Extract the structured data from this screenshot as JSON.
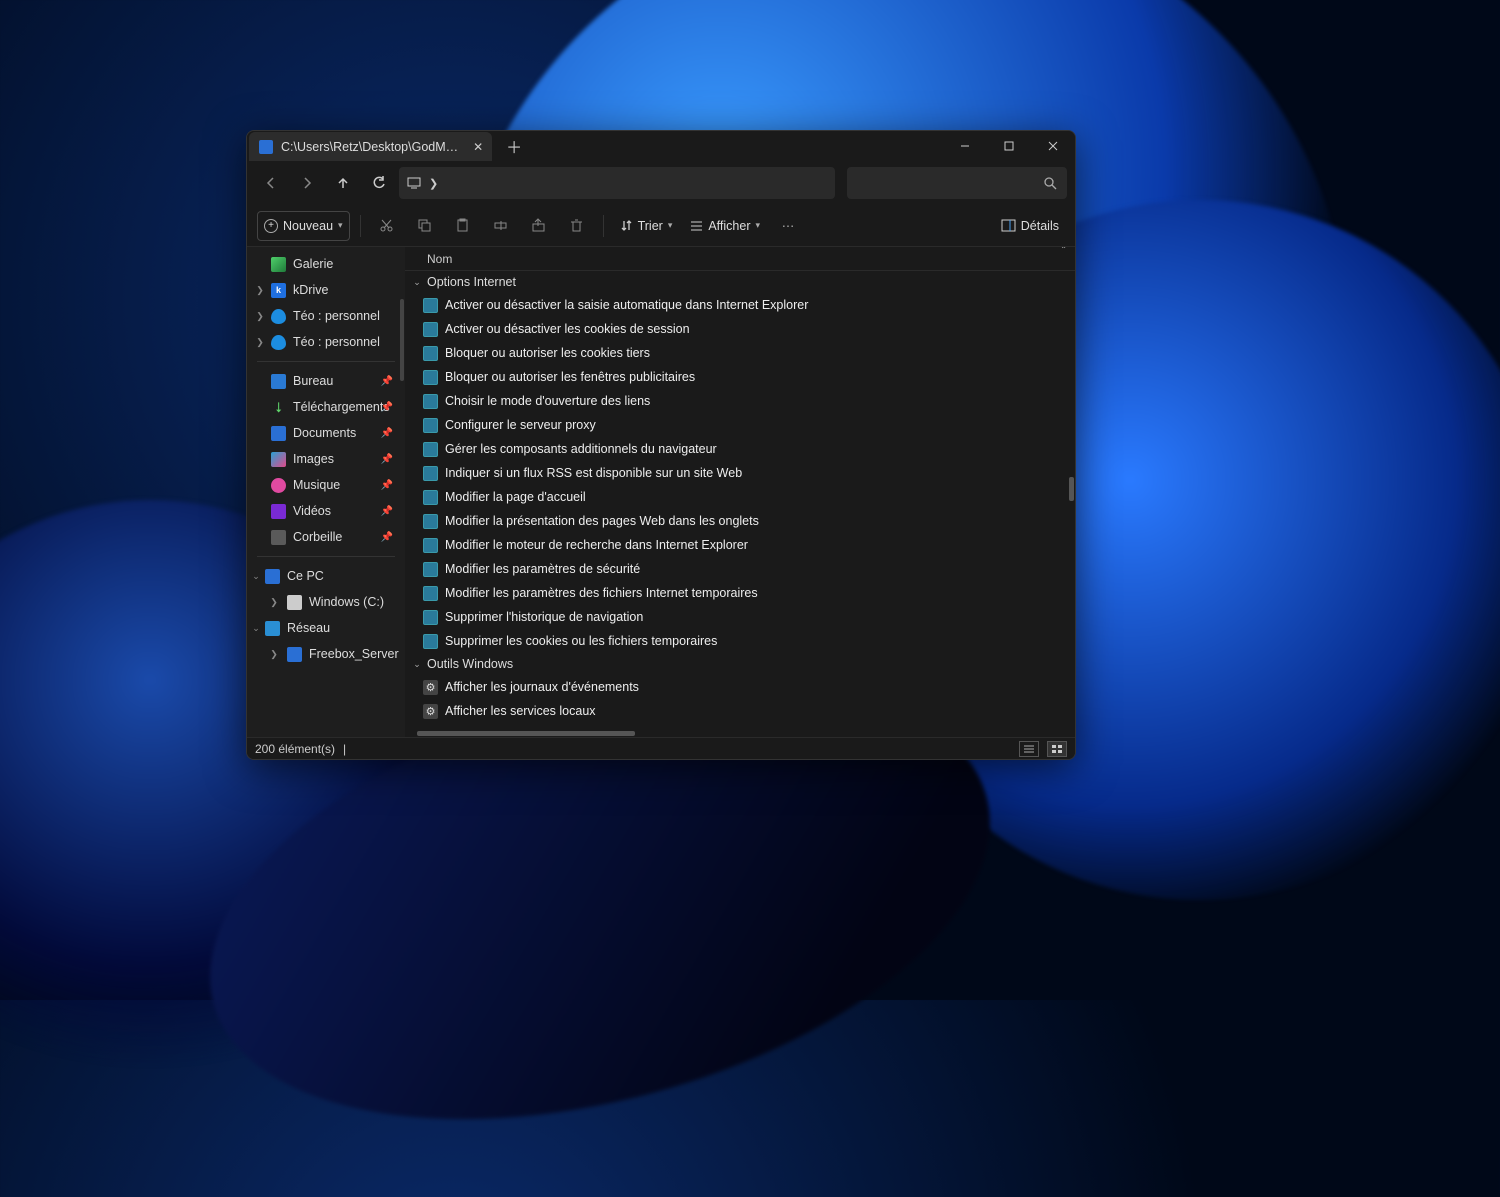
{
  "window": {
    "tab_title": "C:\\Users\\Retz\\Desktop\\GodM…",
    "minimize_label": "Minimize",
    "maximize_label": "Maximize",
    "close_label": "Close"
  },
  "toolbar": {
    "new_label": "Nouveau",
    "sort_label": "Trier",
    "view_label": "Afficher",
    "details_label": "Détails"
  },
  "sidebar": {
    "gallery": "Galerie",
    "kdrive": "kDrive",
    "teo1": "Téo : personnel",
    "teo2": "Téo : personnel",
    "bureau": "Bureau",
    "downloads": "Téléchargements",
    "documents": "Documents",
    "images": "Images",
    "music": "Musique",
    "videos": "Vidéos",
    "trash": "Corbeille",
    "thispc": "Ce PC",
    "windows_c": "Windows (C:)",
    "network": "Réseau",
    "freebox": "Freebox_Server"
  },
  "main": {
    "column_name": "Nom",
    "group1": "Options Internet",
    "items1": [
      "Activer ou désactiver la saisie automatique dans Internet Explorer",
      "Activer ou désactiver les cookies de session",
      "Bloquer ou autoriser les cookies tiers",
      "Bloquer ou autoriser les fenêtres publicitaires",
      "Choisir le mode d'ouverture des liens",
      "Configurer le serveur proxy",
      "Gérer les composants additionnels du navigateur",
      "Indiquer si un flux RSS est disponible sur un site Web",
      "Modifier la page d'accueil",
      "Modifier la présentation des pages Web dans les onglets",
      "Modifier le moteur de recherche dans Internet Explorer",
      "Modifier les paramètres de sécurité",
      "Modifier les paramètres des fichiers Internet temporaires",
      "Supprimer l'historique de navigation",
      "Supprimer les cookies ou les fichiers temporaires"
    ],
    "group2": "Outils Windows",
    "items2": [
      "Afficher les journaux d'événements",
      "Afficher les services locaux"
    ]
  },
  "status": {
    "count": "200 élément(s)"
  }
}
